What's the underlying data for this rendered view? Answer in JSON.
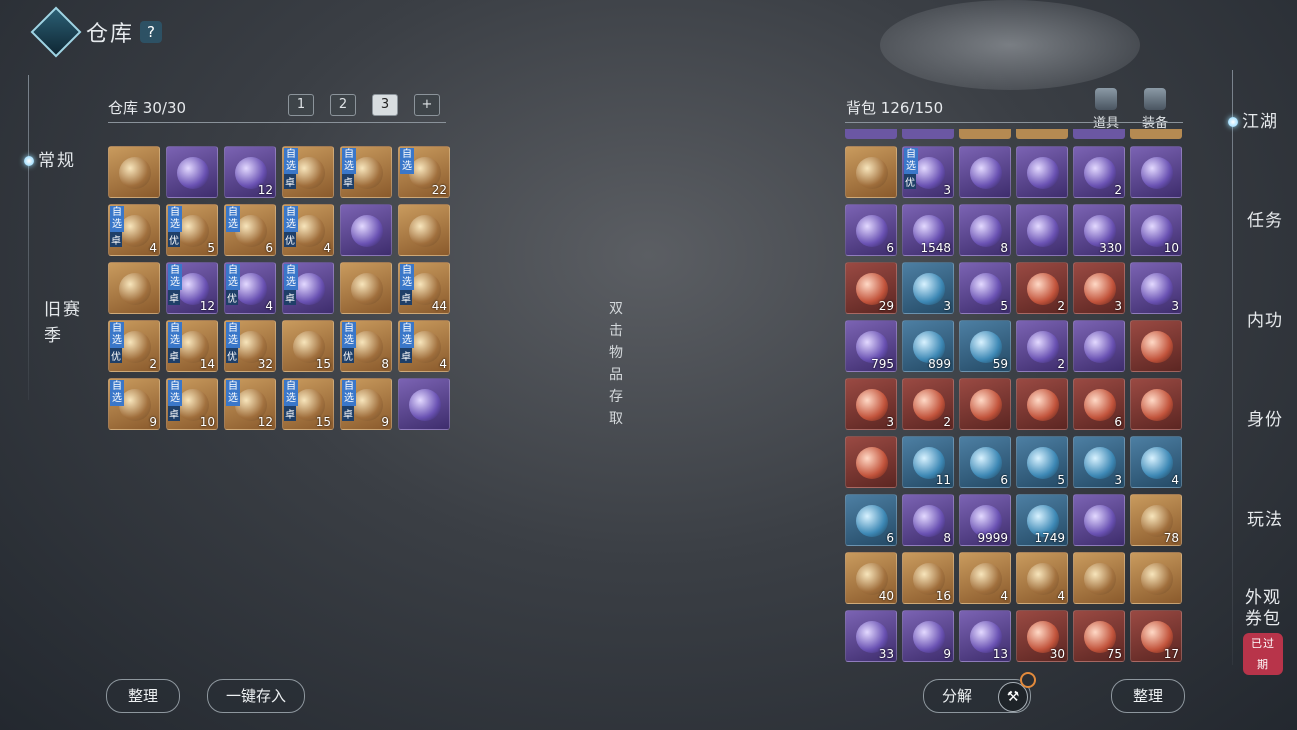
{
  "header": {
    "title": "仓库",
    "help": "?"
  },
  "left_nav": {
    "active": "常规",
    "items": [
      "常规",
      "旧赛季"
    ]
  },
  "warehouse": {
    "label": "仓库",
    "capacity": "30/30",
    "tabs": [
      "1",
      "2",
      "3",
      "+"
    ],
    "active_tab": "3",
    "slots": [
      {
        "q": "gold",
        "count": ""
      },
      {
        "q": "purple",
        "count": ""
      },
      {
        "q": "purple",
        "count": "12"
      },
      {
        "q": "gold",
        "tag": "自选",
        "grade": "卓",
        "count": ""
      },
      {
        "q": "gold",
        "tag": "自选",
        "grade": "卓",
        "count": ""
      },
      {
        "q": "gold",
        "tag": "自选",
        "count": "22"
      },
      {
        "q": "gold",
        "tag": "自选",
        "grade": "卓",
        "count": "4"
      },
      {
        "q": "gold",
        "tag": "自选",
        "grade": "优",
        "count": "5"
      },
      {
        "q": "gold",
        "tag": "自选",
        "count": "6"
      },
      {
        "q": "gold",
        "tag": "自选",
        "grade": "优",
        "count": "4"
      },
      {
        "q": "purple",
        "count": ""
      },
      {
        "q": "gold",
        "count": ""
      },
      {
        "q": "gold",
        "count": ""
      },
      {
        "q": "purple",
        "tag": "自选",
        "grade": "卓",
        "count": "12"
      },
      {
        "q": "purple",
        "tag": "自选",
        "grade": "优",
        "count": "4"
      },
      {
        "q": "purple",
        "tag": "自选",
        "grade": "卓",
        "count": ""
      },
      {
        "q": "gold",
        "count": ""
      },
      {
        "q": "gold",
        "tag": "自选",
        "grade": "卓",
        "count": "44"
      },
      {
        "q": "gold",
        "tag": "自选",
        "grade": "优",
        "count": "2"
      },
      {
        "q": "gold",
        "tag": "自选",
        "grade": "卓",
        "count": "14"
      },
      {
        "q": "gold",
        "tag": "自选",
        "grade": "优",
        "count": "32"
      },
      {
        "q": "gold",
        "count": "15"
      },
      {
        "q": "gold",
        "tag": "自选",
        "grade": "优",
        "count": "8"
      },
      {
        "q": "gold",
        "tag": "自选",
        "grade": "卓",
        "count": "4"
      },
      {
        "q": "gold",
        "tag": "自选",
        "count": "9"
      },
      {
        "q": "gold",
        "tag": "自选",
        "grade": "卓",
        "count": "10"
      },
      {
        "q": "gold",
        "tag": "自选",
        "count": "12"
      },
      {
        "q": "gold",
        "tag": "自选",
        "grade": "卓",
        "count": "15"
      },
      {
        "q": "gold",
        "tag": "自选",
        "grade": "卓",
        "count": "9"
      },
      {
        "q": "purple",
        "count": ""
      }
    ],
    "buttons": {
      "sort": "整理",
      "deposit_all": "一键存入"
    }
  },
  "middle_hint": [
    "双",
    "击",
    "物",
    "品",
    "存",
    "取"
  ],
  "backpack": {
    "label": "背包",
    "capacity": "126/150",
    "sub_tabs": [
      "道具",
      "装备"
    ],
    "slots": [
      {
        "q": "gold",
        "count": ""
      },
      {
        "q": "purple",
        "tag": "自选",
        "grade": "优",
        "count": "3"
      },
      {
        "q": "purple",
        "count": ""
      },
      {
        "q": "purple",
        "count": ""
      },
      {
        "q": "purple",
        "count": "2"
      },
      {
        "q": "purple",
        "count": ""
      },
      {
        "q": "purple",
        "count": "6"
      },
      {
        "q": "purple",
        "count": "1548"
      },
      {
        "q": "purple",
        "count": "8"
      },
      {
        "q": "purple",
        "count": ""
      },
      {
        "q": "purple",
        "count": "330"
      },
      {
        "q": "purple",
        "count": "10"
      },
      {
        "q": "red",
        "count": "29"
      },
      {
        "q": "blue",
        "count": "3"
      },
      {
        "q": "purple",
        "count": "5"
      },
      {
        "q": "red",
        "count": "2"
      },
      {
        "q": "red",
        "count": "3"
      },
      {
        "q": "purple",
        "count": "3"
      },
      {
        "q": "purple",
        "count": "795"
      },
      {
        "q": "blue",
        "count": "899"
      },
      {
        "q": "blue",
        "count": "59"
      },
      {
        "q": "purple",
        "count": "2"
      },
      {
        "q": "purple",
        "count": ""
      },
      {
        "q": "red",
        "count": ""
      },
      {
        "q": "red",
        "count": "3"
      },
      {
        "q": "red",
        "count": "2"
      },
      {
        "q": "red",
        "count": ""
      },
      {
        "q": "red",
        "count": ""
      },
      {
        "q": "red",
        "count": "6"
      },
      {
        "q": "red",
        "count": ""
      },
      {
        "q": "red",
        "count": ""
      },
      {
        "q": "blue",
        "count": "11"
      },
      {
        "q": "blue",
        "count": "6"
      },
      {
        "q": "blue",
        "count": "5"
      },
      {
        "q": "blue",
        "count": "3"
      },
      {
        "q": "blue",
        "count": "4"
      },
      {
        "q": "blue",
        "count": "6"
      },
      {
        "q": "purple",
        "count": "8"
      },
      {
        "q": "purple",
        "count": "9999"
      },
      {
        "q": "blue",
        "count": "1749"
      },
      {
        "q": "purple",
        "count": ""
      },
      {
        "q": "gold",
        "count": "78"
      },
      {
        "q": "gold",
        "count": "40"
      },
      {
        "q": "gold",
        "count": "16"
      },
      {
        "q": "gold",
        "count": "4"
      },
      {
        "q": "gold",
        "count": "4"
      },
      {
        "q": "gold",
        "count": ""
      },
      {
        "q": "gold",
        "count": ""
      },
      {
        "q": "purple",
        "count": "33"
      },
      {
        "q": "purple",
        "count": "9"
      },
      {
        "q": "purple",
        "count": "13"
      },
      {
        "q": "red",
        "count": "30"
      },
      {
        "q": "red",
        "count": "75"
      },
      {
        "q": "red",
        "count": "17"
      }
    ],
    "buttons": {
      "decompose": "分解",
      "sort": "整理"
    }
  },
  "right_nav": {
    "active": "江湖",
    "items": [
      "江湖",
      "任务",
      "内功",
      "身份",
      "玩法",
      "外观券包"
    ],
    "expired_badge": "已过期"
  },
  "icons": {
    "logo": "diamond-logo-icon",
    "decompose": "hammer-icon",
    "notice": "notice-ring-icon"
  }
}
